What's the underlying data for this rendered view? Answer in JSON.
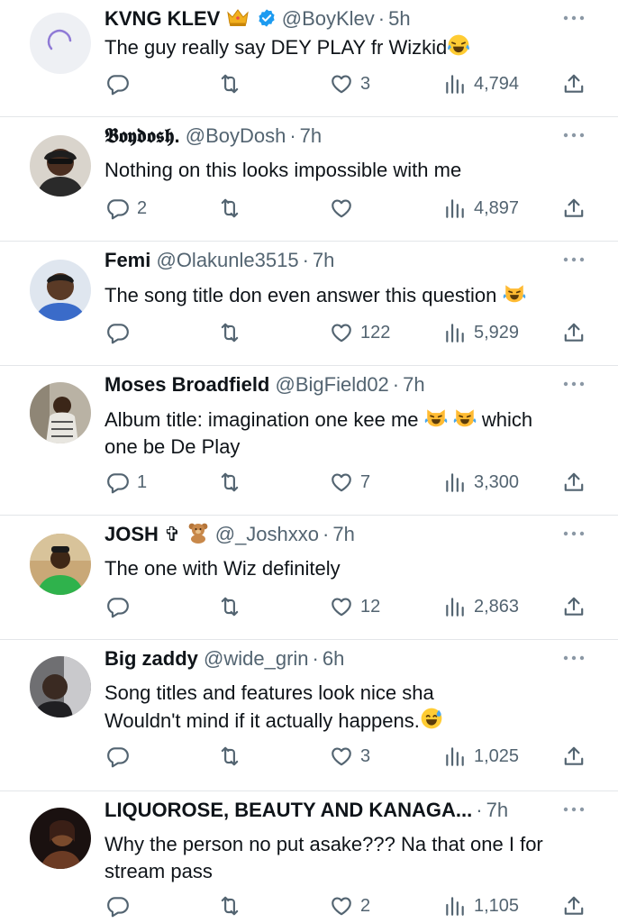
{
  "tweets": [
    {
      "name": "KVNG KLEV",
      "badge": "crown-emoji",
      "verified": true,
      "handle": "@BoyKlev",
      "time": "5h",
      "lines": [
        "The guy really say DEY PLAY fr Wizkid"
      ],
      "trailing_emoji": "tears-of-joy-emoji",
      "replies": "",
      "retweets": "",
      "likes": "3",
      "views": "4,794"
    },
    {
      "name": "𝕭𝖔𝖞𝖉𝖔𝖘𝖍.",
      "handle": "@BoyDosh",
      "time": "7h",
      "lines": [
        "Nothing on this looks impossible with me"
      ],
      "replies": "2",
      "retweets": "",
      "likes": "",
      "views": "4,897"
    },
    {
      "name": "Femi",
      "handle": "@Olakunle3515",
      "time": "7h",
      "lines": [
        "The song title don even answer this question"
      ],
      "trailing_emoji": "laughing-cat-emoji",
      "replies": "",
      "retweets": "",
      "likes": "122",
      "views": "5,929"
    },
    {
      "name": "Moses Broadfield",
      "handle": "@BigField02",
      "time": "7h",
      "lines": [
        "Album title: imagination one kee me",
        "one be De Play"
      ],
      "line1_suffix": "which",
      "replies": "1",
      "retweets": "",
      "likes": "7",
      "views": "3,300"
    },
    {
      "name": "JOSH",
      "name_suffix": "✞",
      "badge": "teddy-bear-emoji",
      "handle": "@_Joshxxo",
      "time": "7h",
      "lines": [
        "The one with Wiz definitely"
      ],
      "replies": "",
      "retweets": "",
      "likes": "12",
      "views": "2,863"
    },
    {
      "name": "Big zaddy",
      "handle": "@wide_grin",
      "time": "6h",
      "lines": [
        "Song titles and features look nice sha",
        "Wouldn't mind if it actually happens."
      ],
      "trailing_emoji": "grinning-sweat-emoji",
      "replies": "",
      "retweets": "",
      "likes": "3",
      "views": "1,025"
    },
    {
      "name": "LIQUOROSE, BEAUTY AND KANAGA...",
      "handle": "",
      "time": "7h",
      "lines": [
        "Why the person no put asake??? Na that one I for",
        "stream pass"
      ],
      "replies": "",
      "retweets": "",
      "likes": "2",
      "views": "1,105"
    }
  ],
  "colors": {
    "text": "#0f1419",
    "secondary": "#536471",
    "verified": "#1d9bf0",
    "divider": "#e3e6e9"
  }
}
